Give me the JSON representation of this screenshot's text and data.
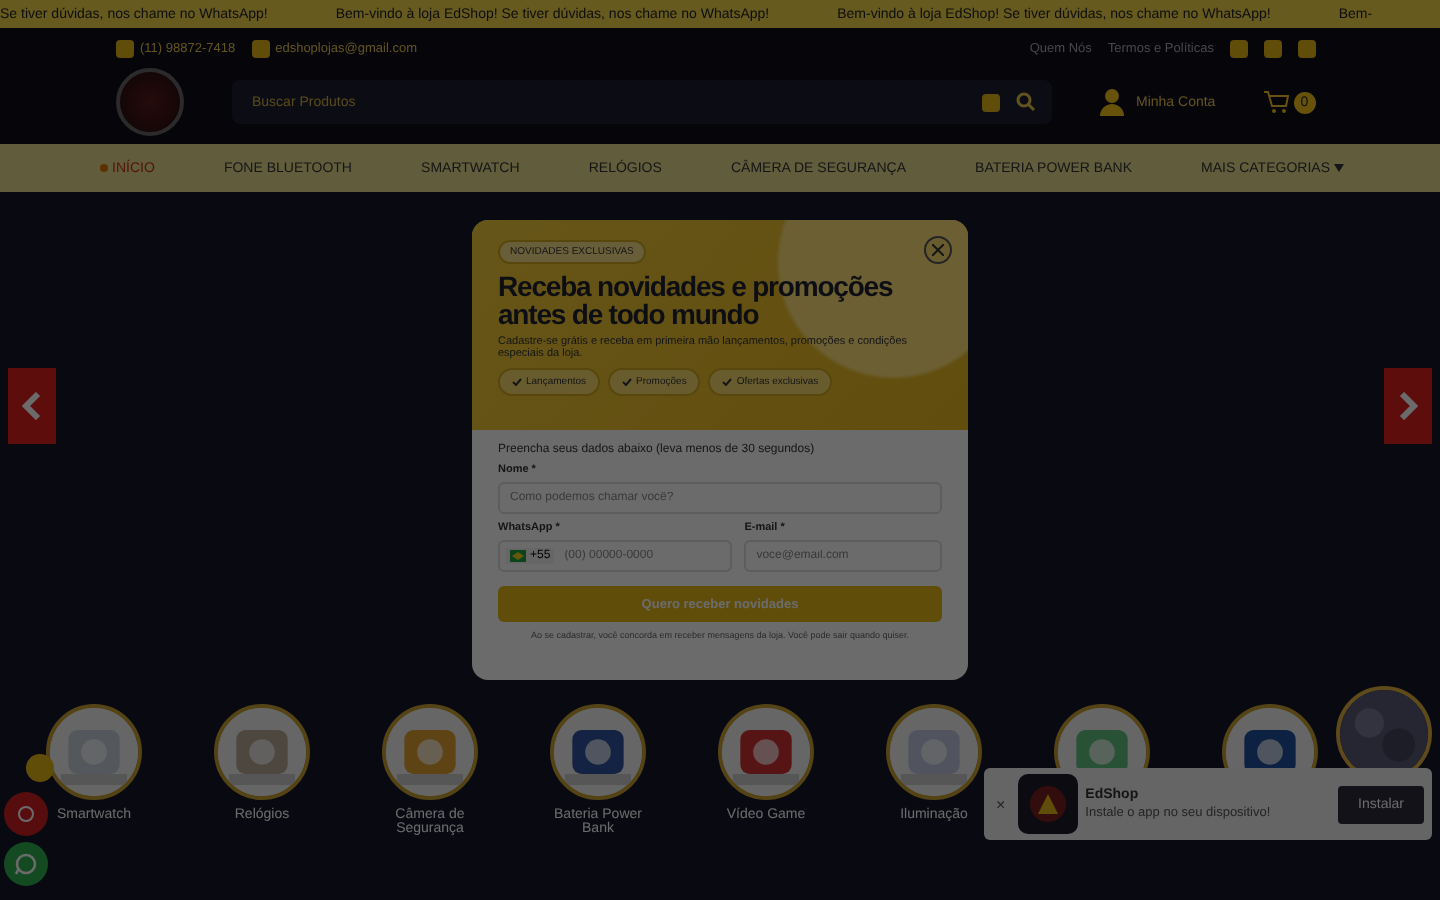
{
  "announcement_bar": {
    "messages": [
      "Se tiver dúvidas, nos chame no WhatsApp!",
      "Bem-vindo à loja EdShop! Se tiver dúvidas, nos chame no WhatsApp!",
      "Bem-vindo à loja EdShop! Se tiver dúvidas, nos chame no WhatsApp!",
      "Bem-"
    ]
  },
  "top_bar": {
    "phone": "(11) 98872-7418",
    "email": "edshoplojas@gmail.com",
    "links": [
      "Quem Nós",
      "Termos e Políticas"
    ]
  },
  "header": {
    "search": {
      "placeholder": "Buscar Produtos"
    },
    "account": "Minha Conta",
    "cart_count": "0"
  },
  "nav": [
    {
      "label": "INÍCIO",
      "selected": true,
      "dropdown": false
    },
    {
      "label": "FONE BLUETOOTH",
      "selected": false,
      "dropdown": false
    },
    {
      "label": "SMARTWATCH",
      "selected": false,
      "dropdown": false
    },
    {
      "label": "RELÓGIOS",
      "selected": false,
      "dropdown": false
    },
    {
      "label": "CÂMERA DE SEGURANÇA",
      "selected": false,
      "dropdown": false
    },
    {
      "label": "BATERIA POWER BANK",
      "selected": false,
      "dropdown": false
    },
    {
      "label": "MAIS CATEGORIAS",
      "selected": false,
      "dropdown": true
    }
  ],
  "categories": [
    {
      "kind": "labeled",
      "label": "Smartwatch"
    },
    {
      "kind": "labeled",
      "label": "Relógios"
    },
    {
      "kind": "labeled",
      "label": "Câmera de Segurança"
    },
    {
      "kind": "labeled",
      "label": "Bateria Power Bank"
    },
    {
      "kind": "labeled",
      "label": "Vídeo Game"
    },
    {
      "kind": "labeled",
      "label": "Iluminação"
    },
    {
      "kind": "unlabeled"
    },
    {
      "kind": "unlabeled"
    }
  ],
  "modal": {
    "badge": "NOVIDADES EXCLUSIVAS",
    "title": "Receba novidades e promoções antes de todo mundo",
    "subtitle": "Cadastre-se grátis e receba em primeira mão lançamentos, promoções e condições especiais da loja.",
    "chips": [
      "Lançamentos",
      "Promoções",
      "Ofertas exclusivas"
    ],
    "intro": "Preencha seus dados abaixo (leva menos de 30 segundos)",
    "fields": [
      {
        "label": "Nome *",
        "placeholder": "Como podemos chamar você?"
      }
    ],
    "whatsapp": {
      "label": "WhatsApp *",
      "country_code": "+55",
      "placeholder": "(00) 00000-0000"
    },
    "email": {
      "label": "E-mail *",
      "placeholder": "voce@email.com"
    },
    "submit": "Quero receber novidades",
    "disclaimer": "Ao se cadastrar, você concorda em receber mensagens da loja. Você pode sair quando quiser."
  },
  "install_prompt": {
    "close": "×",
    "app_name": "EdShop",
    "message": "Instale o app no seu dispositivo!",
    "button": "Instalar"
  }
}
